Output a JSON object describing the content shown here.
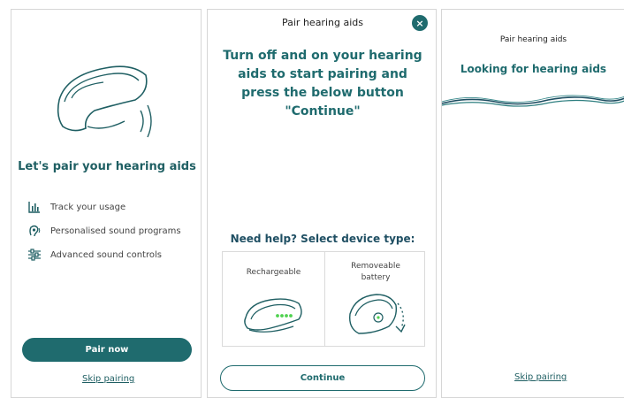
{
  "screen1": {
    "title": "Let's pair your hearing aids",
    "features": [
      {
        "icon": "chart-icon",
        "label": "Track your usage"
      },
      {
        "icon": "sound-program-icon",
        "label": "Personalised sound programs"
      },
      {
        "icon": "sliders-icon",
        "label": "Advanced sound controls"
      }
    ],
    "pair_button": "Pair now",
    "skip_link": "Skip pairing"
  },
  "screen2": {
    "header": "Pair hearing aids",
    "close_icon": "×",
    "instruction": "Turn off and on your hearing aids to start pairing and press the below button \"Continue\"",
    "help_title": "Need help? Select device type:",
    "devices": [
      {
        "label": "Rechargeable"
      },
      {
        "label": "Removeable battery"
      }
    ],
    "continue_button": "Continue"
  },
  "screen3": {
    "header": "Pair hearing aids",
    "status": "Looking for hearing aids",
    "skip_link": "Skip pairing"
  },
  "colors": {
    "brand": "#1f6b6e",
    "led": "#4fd24f",
    "text": "#444444"
  }
}
